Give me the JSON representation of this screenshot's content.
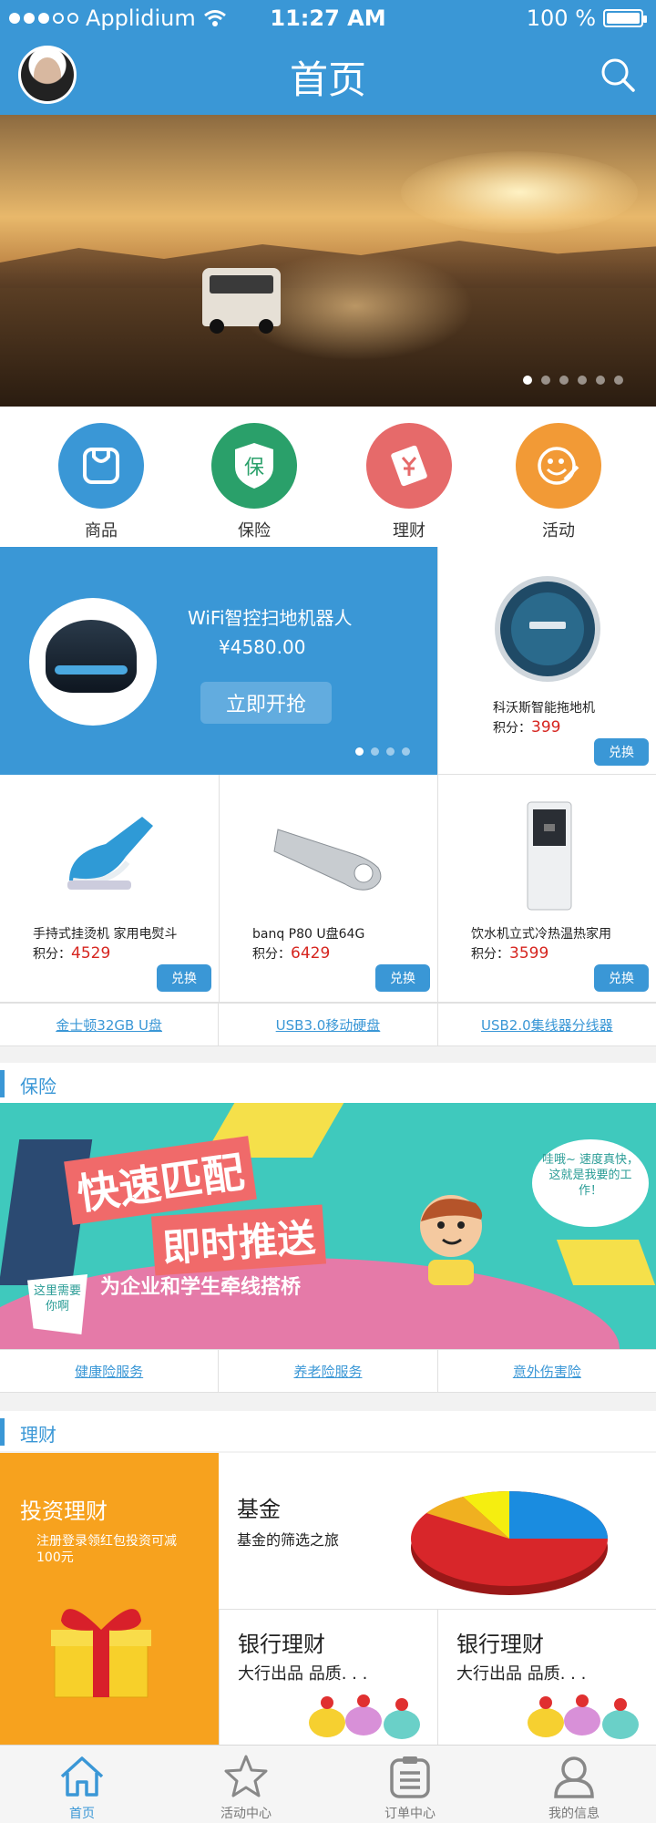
{
  "status": {
    "carrier": "Applidium",
    "time": "11:27 AM",
    "battery": "100 %",
    "signal_bars": 5,
    "signal_filled": 3
  },
  "header": {
    "title": "首页"
  },
  "banner": {
    "pages": 6,
    "active_page": 1
  },
  "categories": [
    {
      "label": "商品",
      "color": "#3a97d6",
      "icon": "bag-icon"
    },
    {
      "label": "保险",
      "color": "#2aa06a",
      "icon": "shield-icon",
      "glyph": "保"
    },
    {
      "label": "理财",
      "color": "#e66a6a",
      "icon": "money-card-icon"
    },
    {
      "label": "活动",
      "color": "#f29a36",
      "icon": "smile-pen-icon"
    }
  ],
  "promo": {
    "name": "WiFi智控扫地机器人",
    "price": "¥4580.00",
    "button": "立即开抢",
    "pages": 4,
    "active_page": 1
  },
  "points_label": "积分：",
  "exchange_label": "兑换",
  "products": [
    {
      "name": "科沃斯智能拖地机",
      "points": "399"
    },
    {
      "name": "手持式挂烫机 家用电熨斗",
      "points": "4529"
    },
    {
      "name": "banq P80 U盘64G",
      "points": "6429"
    },
    {
      "name": "饮水机立式冷热温热家用",
      "points": "3599"
    }
  ],
  "product_links": [
    "金士顿32GB U盘",
    "USB3.0移动硬盘",
    "USB2.0集线器分线器"
  ],
  "insurance": {
    "section": "保险",
    "headline1": "快速匹配",
    "headline2": "即时推送",
    "tagline": "为企业和学生牵线搭桥",
    "bubble_right": "哇哦~ 速度真快，这就是我要的工作！",
    "bubble_left": "这里需要你啊",
    "links": [
      "健康险服务",
      "养老险服务",
      "意外伤害险"
    ]
  },
  "finance": {
    "section": "理财",
    "invest_title": "投资理财",
    "invest_sub": "注册登录领红包投资可减100元",
    "fund_title": "基金",
    "fund_sub": "基金的筛选之旅",
    "bank_cards": [
      {
        "title": "银行理财",
        "sub": "大行出品 品质. . ."
      },
      {
        "title": "银行理财",
        "sub": "大行出品 品质. . ."
      }
    ]
  },
  "tabs": [
    {
      "label": "首页",
      "icon": "home-icon",
      "active": true
    },
    {
      "label": "活动中心",
      "icon": "star-icon",
      "active": false
    },
    {
      "label": "订单中心",
      "icon": "order-icon",
      "active": false
    },
    {
      "label": "我的信息",
      "icon": "user-icon",
      "active": false
    }
  ]
}
